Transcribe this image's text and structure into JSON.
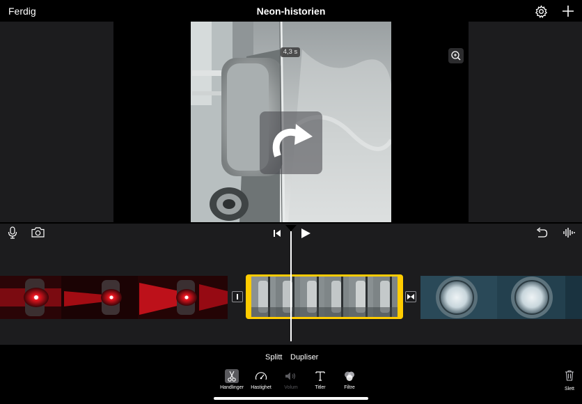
{
  "topbar": {
    "done_label": "Ferdig",
    "title": "Neon-historien",
    "settings_icon": "gear-icon",
    "add_icon": "plus-icon"
  },
  "viewer": {
    "clip_duration": "4,3 s",
    "rotate_icon": "rotate-clockwise-icon",
    "zoom_icon": "zoom-in-icon"
  },
  "timeline": {
    "mic_icon": "microphone-icon",
    "camera_icon": "camera-icon",
    "skip_icon": "skip-to-start-icon",
    "play_icon": "play-icon",
    "undo_icon": "undo-icon",
    "audio_icon": "audio-waveform-icon"
  },
  "actions": {
    "split_label": "Splitt",
    "duplicate_label": "Dupliser"
  },
  "toolbar": {
    "tools": [
      {
        "label": "Handlinger",
        "icon": "scissors-icon",
        "active": true
      },
      {
        "label": "Hastighet",
        "icon": "speedometer-icon",
        "active": false
      },
      {
        "label": "Volum",
        "icon": "speaker-icon",
        "disabled": true
      },
      {
        "label": "Titler",
        "icon": "title-t-icon",
        "active": false
      },
      {
        "label": "Filtre",
        "icon": "filters-icon",
        "active": false
      }
    ],
    "delete_label": "Slett",
    "delete_icon": "trash-icon"
  },
  "colors": {
    "selection": "#ffcc00",
    "panel": "#1c1c1e",
    "background": "#000000"
  }
}
